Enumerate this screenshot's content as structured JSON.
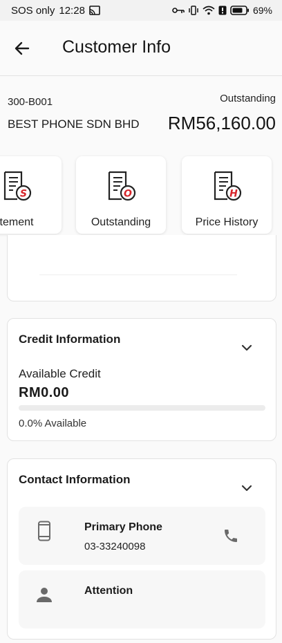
{
  "status_bar": {
    "carrier": "SOS only",
    "time": "12:28",
    "battery": "69%"
  },
  "app_bar": {
    "title": "Customer Info"
  },
  "customer": {
    "code": "300-B001",
    "name": "BEST PHONE SDN BHD",
    "outstanding_label": "Outstanding",
    "outstanding_amount": "RM56,160.00"
  },
  "actions": [
    {
      "label": "tement",
      "icon_letter": "S"
    },
    {
      "label": "Outstanding",
      "icon_letter": "O"
    },
    {
      "label": "Price History",
      "icon_letter": "H"
    }
  ],
  "credit": {
    "title": "Credit Information",
    "available_label": "Available Credit",
    "available_value": "RM0.00",
    "available_fraction": 0.0,
    "available_text": "0.0% Available"
  },
  "contact": {
    "title": "Contact Information",
    "items": [
      {
        "title": "Primary Phone",
        "value": "03-33240098"
      },
      {
        "title": "Attention",
        "value": ""
      }
    ]
  },
  "colors": {
    "accent_red": "#d7262b",
    "background": "#fafafa",
    "card": "#ffffff"
  }
}
